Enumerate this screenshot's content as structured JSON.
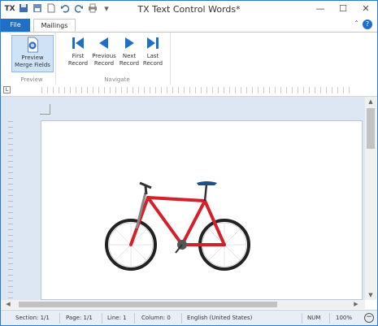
{
  "window": {
    "title": "TX Text Control Words*",
    "app_icon": "TX",
    "controls": {
      "minimize": "—",
      "maximize": "☐",
      "close": "✕"
    }
  },
  "quick_access": [
    "save-icon",
    "save-as-icon",
    "new-icon",
    "undo-icon",
    "redo-icon",
    "print-icon",
    "customize-icon"
  ],
  "tabs": [
    {
      "label": "File"
    },
    {
      "label": "Mailings"
    }
  ],
  "ribbon": {
    "groups": [
      {
        "label": "Preview",
        "buttons": [
          {
            "label": "Preview Merge Fields"
          }
        ]
      },
      {
        "label": "Navigate",
        "buttons": [
          {
            "label": "First Record"
          },
          {
            "label": "Previous Record"
          },
          {
            "label": "Next Record"
          },
          {
            "label": "Last Record"
          }
        ]
      }
    ]
  },
  "ruler": {
    "corner": "L"
  },
  "document": {
    "image": "bicycle"
  },
  "status_bar": {
    "section": "Section: 1/1",
    "page": "Page: 1/1",
    "line": "Line: 1",
    "column": "Column: 0",
    "language": "English (United States)",
    "num": "NUM",
    "zoom": "100%"
  },
  "colors": {
    "accent": "#1e6fc8",
    "bike_frame": "#d3202a",
    "doc_background": "#dde7f3"
  }
}
